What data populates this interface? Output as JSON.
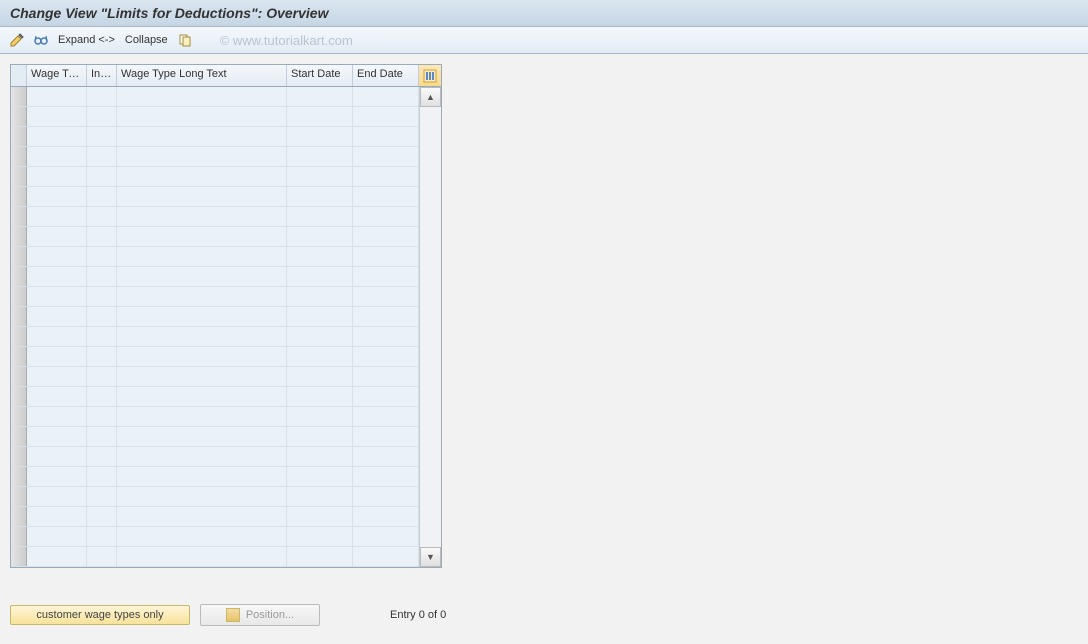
{
  "title": "Change View \"Limits for Deductions\": Overview",
  "watermark": "© www.tutorialkart.com",
  "toolbar": {
    "expand": "Expand <->",
    "collapse": "Collapse"
  },
  "columns": {
    "wage_type": "Wage Ty...",
    "inf": "Inf...",
    "wage_long": "Wage Type Long Text",
    "start": "Start Date",
    "end": "End Date"
  },
  "rows": [
    {},
    {},
    {},
    {},
    {},
    {},
    {},
    {},
    {},
    {},
    {},
    {},
    {},
    {},
    {},
    {},
    {},
    {},
    {},
    {},
    {},
    {},
    {},
    {}
  ],
  "buttons": {
    "customer_wage": "customer wage types only",
    "position": "Position..."
  },
  "status": "Entry 0 of 0"
}
